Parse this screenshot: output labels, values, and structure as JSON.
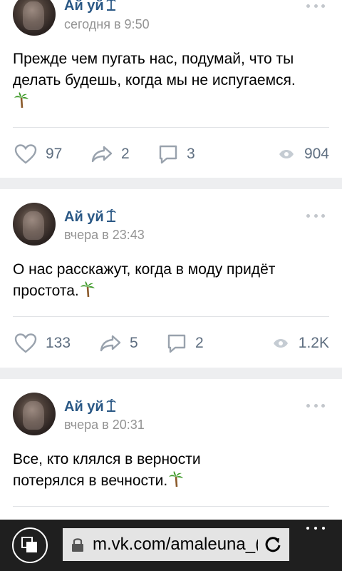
{
  "posts": [
    {
      "author": "Ай уй",
      "time": "сегодня в 9:50",
      "text": "Прежде чем пугать нас, подумай, что ты делать будешь, когда мы не испугаемся.",
      "likes": "97",
      "shares": "2",
      "comments": "3",
      "views": "904"
    },
    {
      "author": "Ай уй",
      "time": "вчера в 23:43",
      "text": "О нас расскажут, когда в моду придёт простота.",
      "likes": "133",
      "shares": "5",
      "comments": "2",
      "views": "1.2K"
    },
    {
      "author": "Ай уй",
      "time": "вчера в 20:31",
      "text_line1": "Все, кто клялся в верности",
      "text_line2": "потерялся в вечности."
    }
  ],
  "browser": {
    "url": "m.vk.com/amaleuna_("
  },
  "colors": {
    "author": "#2a5885",
    "meta": "#939393",
    "action": "#5e6e80",
    "bar": "#1f1f1f"
  },
  "icons": [
    "more-icon",
    "palm-tree-icon",
    "island-icon",
    "like-icon",
    "share-icon",
    "comment-icon",
    "views-icon",
    "tabs-icon",
    "lock-icon",
    "refresh-icon"
  ]
}
